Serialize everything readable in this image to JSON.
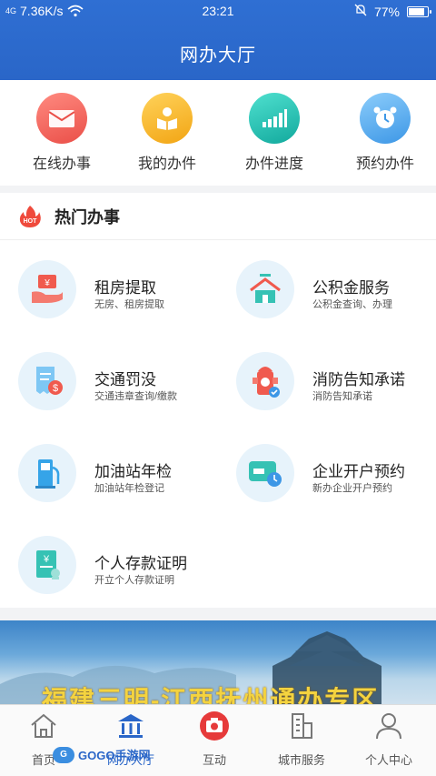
{
  "status_bar": {
    "signal": "4G",
    "network_speed": "7.36K/s",
    "time": "23:21",
    "battery": "77%",
    "battery_level": 0.77
  },
  "header": {
    "title": "网办大厅"
  },
  "quick_actions": [
    {
      "label": "在线办事",
      "icon": "envelope-icon",
      "color": "#f0625a"
    },
    {
      "label": "我的办件",
      "icon": "reading-person-icon",
      "color": "#f5b01f"
    },
    {
      "label": "办件进度",
      "icon": "bar-progress-icon",
      "color": "#23c2b5"
    },
    {
      "label": "预约办件",
      "icon": "alarm-clock-icon",
      "color": "#4ba9f0"
    }
  ],
  "hot_section": {
    "badge": "HOT",
    "title": "热门办事",
    "services": [
      {
        "name": "租房提取",
        "desc": "无房、租房提取",
        "icon": "rent-withdraw-icon"
      },
      {
        "name": "公积金服务",
        "desc": "公积金查询、办理",
        "icon": "house-fund-icon"
      },
      {
        "name": "交通罚没",
        "desc": "交通违章查询/缴款",
        "icon": "traffic-fine-icon"
      },
      {
        "name": "消防告知承诺",
        "desc": "消防告知承诺",
        "icon": "fire-hydrant-icon"
      },
      {
        "name": "加油站年检",
        "desc": "加油站年检登记",
        "icon": "gas-station-icon"
      },
      {
        "name": "企业开户预约",
        "desc": "新办企业开户预约",
        "icon": "bank-card-clock-icon"
      },
      {
        "name": "个人存款证明",
        "desc": "开立个人存款证明",
        "icon": "deposit-certificate-icon"
      }
    ]
  },
  "banner": {
    "text": "福建三明-江西抚州通办专区"
  },
  "bottom_nav": [
    {
      "label": "首页",
      "icon": "home-icon",
      "active": false
    },
    {
      "label": "网办大厅",
      "icon": "hall-icon",
      "active": true
    },
    {
      "label": "互动",
      "icon": "camera-icon",
      "active": false
    },
    {
      "label": "城市服务",
      "icon": "city-building-icon",
      "active": false
    },
    {
      "label": "个人中心",
      "icon": "person-icon",
      "active": false
    }
  ],
  "watermark": {
    "logo": "G",
    "text": "GOGO手游网"
  }
}
